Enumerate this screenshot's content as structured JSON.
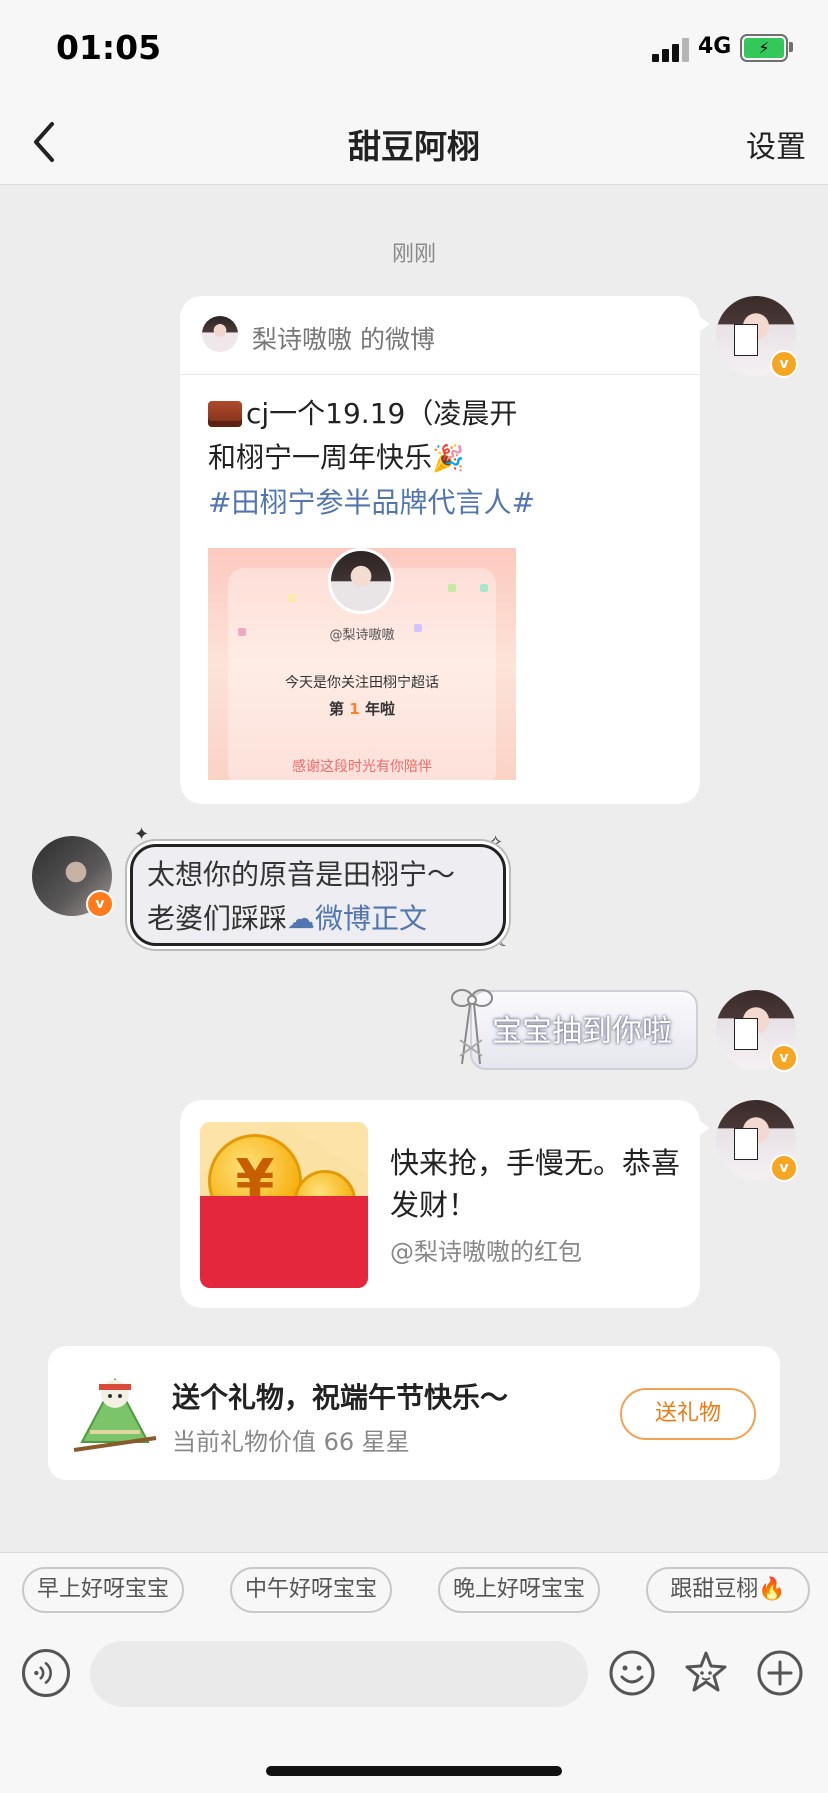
{
  "status": {
    "time": "01:05",
    "network": "4G"
  },
  "nav": {
    "title": "甜豆阿栩",
    "settings_label": "设置"
  },
  "chat": {
    "timestamp": "刚刚",
    "weibo_card": {
      "source": "梨诗嗷嗷 的微博",
      "line1": "cj一个19.19（凌晨开",
      "line2": "和栩宁一周年快乐",
      "hashtag": "#田栩宁参半品牌代言人#",
      "image": {
        "username": "@梨诗嗷嗷",
        "line1": "今天是你关注田栩宁超话",
        "prefix": "第",
        "count": "1",
        "suffix": "年啦",
        "footer": "感谢这段时光有你陪伴"
      }
    },
    "fancy_message": {
      "line1": "太想你的原音是田栩宁～",
      "line2_prefix": "老婆们踩踩",
      "link_label": "微博正文"
    },
    "bow_message": {
      "text": "宝宝抽到你啦"
    },
    "red_packet": {
      "title": "快来抢，手慢无。恭喜发财！",
      "subtitle": "@梨诗嗷嗷的红包",
      "coin_symbol": "¥"
    },
    "gift_card": {
      "title": "送个礼物，祝端午节快乐～",
      "subtitle": "当前礼物价值 66 星星",
      "button_label": "送礼物"
    }
  },
  "quick_replies": [
    {
      "label": "早上好呀宝宝"
    },
    {
      "label": "中午好呀宝宝"
    },
    {
      "label": "晚上好呀宝宝"
    },
    {
      "label": "跟甜豆栩"
    }
  ],
  "input": {
    "placeholder": ""
  },
  "colors": {
    "accent": "#f07a12",
    "link": "#5276b0",
    "verified": "#f5a623",
    "battery": "#34c759"
  },
  "icons": [
    "back-chevron-icon",
    "voice-icon",
    "emoji-icon",
    "sticker-icon",
    "plus-icon",
    "fire-icon",
    "verified-badge-icon"
  ]
}
